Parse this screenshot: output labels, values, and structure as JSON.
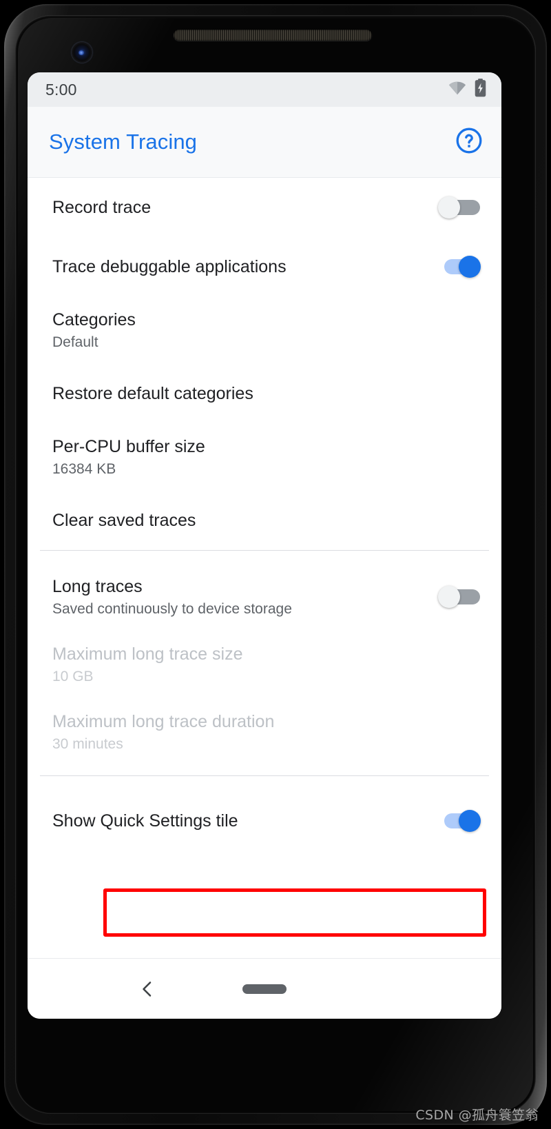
{
  "device": {
    "front_camera_icon": "front-camera-lens",
    "earpiece_icon": "earpiece-speaker-grille"
  },
  "status_bar": {
    "time": "5:00",
    "icons": [
      "wifi-icon",
      "battery-charging-icon"
    ]
  },
  "app_bar": {
    "title": "System Tracing",
    "help_icon": "help-circle-icon"
  },
  "settings": {
    "groups": [
      {
        "name": "trace-settings",
        "rows": [
          {
            "name": "record-trace",
            "title": "Record trace",
            "summary": "",
            "control": "switch",
            "switch_state": "off",
            "disabled": false
          },
          {
            "name": "trace-debuggable-applications",
            "title": "Trace debuggable applications",
            "summary": "",
            "control": "switch",
            "switch_state": "on",
            "disabled": false
          },
          {
            "name": "categories",
            "title": "Categories",
            "summary": "Default",
            "control": "none",
            "disabled": false
          },
          {
            "name": "restore-default-categories",
            "title": "Restore default categories",
            "summary": "",
            "control": "none",
            "disabled": false
          },
          {
            "name": "per-cpu-buffer-size",
            "title": "Per-CPU buffer size",
            "summary": "16384 KB",
            "control": "none",
            "disabled": false
          },
          {
            "name": "clear-saved-traces",
            "title": "Clear saved traces",
            "summary": "",
            "control": "none",
            "disabled": false
          }
        ]
      },
      {
        "name": "long-traces-settings",
        "rows": [
          {
            "name": "long-traces",
            "title": "Long traces",
            "summary": "Saved continuously to device storage",
            "control": "switch",
            "switch_state": "off",
            "disabled": false
          },
          {
            "name": "maximum-long-trace-size",
            "title": "Maximum long trace size",
            "summary": "10 GB",
            "control": "none",
            "disabled": true
          },
          {
            "name": "maximum-long-trace-duration",
            "title": "Maximum long trace duration",
            "summary": "30 minutes",
            "control": "none",
            "disabled": true
          }
        ]
      },
      {
        "name": "misc-settings",
        "rows": [
          {
            "name": "show-quick-settings-tile",
            "title": "Show Quick Settings tile",
            "summary": "",
            "control": "switch",
            "switch_state": "on",
            "disabled": false,
            "highlighted": true
          }
        ]
      }
    ]
  },
  "annotation": {
    "highlight_color": "#ff0000",
    "target": "show-quick-settings-tile"
  },
  "nav_bar": {
    "back_icon": "chevron-left-icon",
    "home_icon": "home-pill-icon"
  },
  "watermark": {
    "text": "CSDN @孤舟簑笠翁"
  },
  "colors": {
    "accent": "#1a73e8",
    "switch_on_track": "#aecbfa",
    "switch_off_track": "#9aa0a6",
    "title_text": "#202124",
    "summary_text": "#5f6368",
    "disabled_text": "#bdc1c6",
    "status_bar_bg": "#eceef0",
    "app_bar_bg": "#f8f9fa"
  }
}
